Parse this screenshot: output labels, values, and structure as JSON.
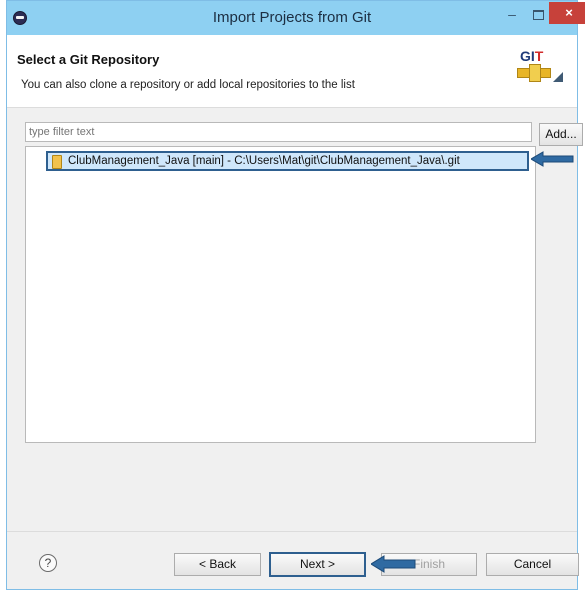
{
  "window": {
    "title": "Import Projects from Git",
    "minimize_glyph": "–",
    "close_glyph": "×"
  },
  "header": {
    "heading": "Select a Git Repository",
    "subheading": "You can also clone a repository or add local repositories to the list",
    "logo_text_main": "GI",
    "logo_text_accent": "T"
  },
  "filter": {
    "placeholder": "type filter text",
    "value": ""
  },
  "buttons": {
    "add": "Add...",
    "back": "< Back",
    "next": "Next >",
    "finish": "Finish",
    "cancel": "Cancel",
    "help": "?"
  },
  "repositories": [
    {
      "label": "ClubManagement_Java [main] - C:\\Users\\Mat\\git\\ClubManagement_Java\\.git",
      "selected": true
    }
  ],
  "icons": {
    "app": "eclipse-icon",
    "repo": "git-repository-icon",
    "help": "help-icon",
    "arrow": "arrow-left-icon"
  },
  "colors": {
    "titlebar": "#8ed0f2",
    "highlight_border": "#2e5f8f",
    "selection": "#cfe7fb",
    "close": "#c7413a"
  }
}
